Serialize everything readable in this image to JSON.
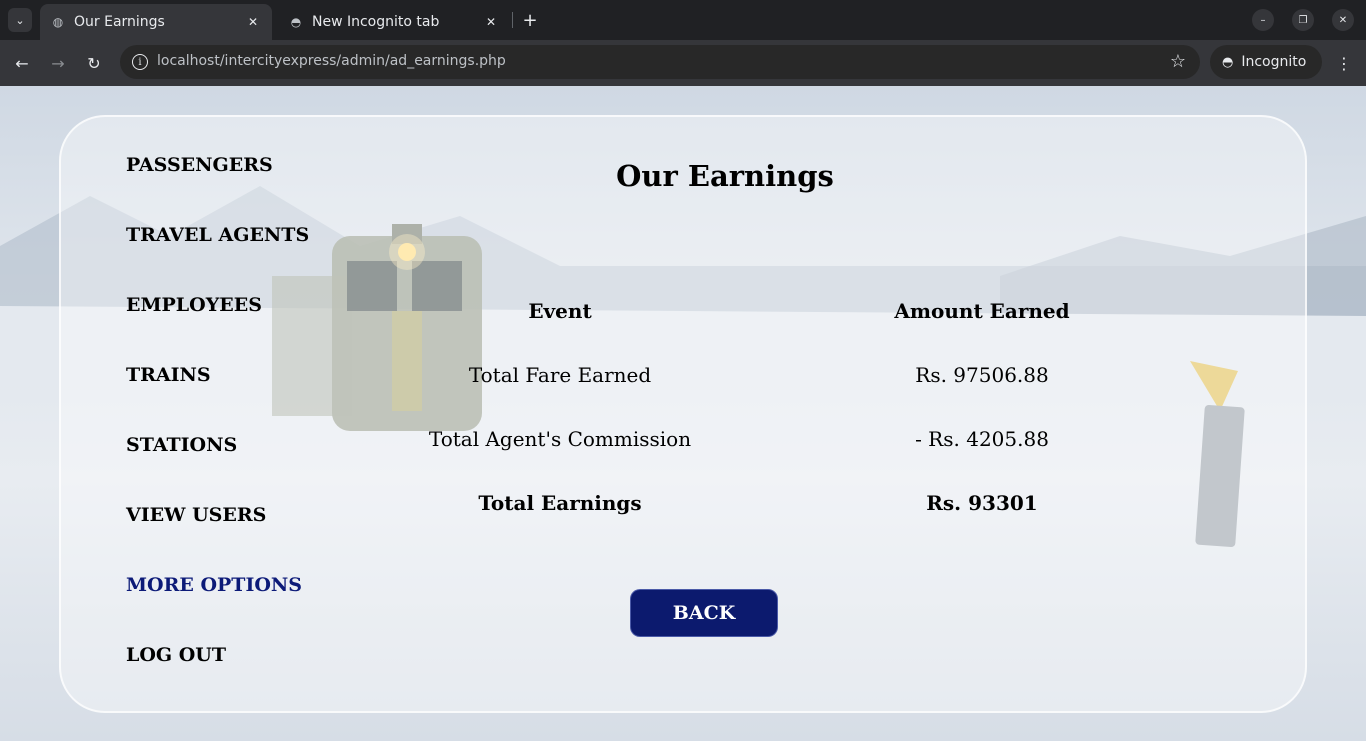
{
  "browser": {
    "tabs": [
      {
        "title": "Our Earnings",
        "active": true
      },
      {
        "title": "New Incognito tab",
        "active": false
      }
    ],
    "url": "localhost/intercityexpress/admin/ad_earnings.php",
    "profile_label": "Incognito"
  },
  "sidebar": {
    "items": [
      {
        "label": "PASSENGERS"
      },
      {
        "label": "TRAVEL AGENTS"
      },
      {
        "label": "EMPLOYEES"
      },
      {
        "label": "TRAINS"
      },
      {
        "label": "STATIONS"
      },
      {
        "label": "VIEW USERS"
      },
      {
        "label": "MORE OPTIONS",
        "highlight": true
      },
      {
        "label": "LOG OUT"
      }
    ]
  },
  "main": {
    "title": "Our Earnings",
    "table": {
      "headers": [
        "Event",
        "Amount Earned"
      ],
      "rows": [
        {
          "event": "Total Fare Earned",
          "amount": "Rs. 97506.88"
        },
        {
          "event": "Total Agent's Commission",
          "amount": "- Rs. 4205.88"
        },
        {
          "event": "Total Earnings",
          "amount": "Rs. 93301"
        }
      ]
    },
    "back_label": "BACK"
  },
  "colors": {
    "accent": "#0c1a6e",
    "highlight_link": "#0c1a78"
  }
}
